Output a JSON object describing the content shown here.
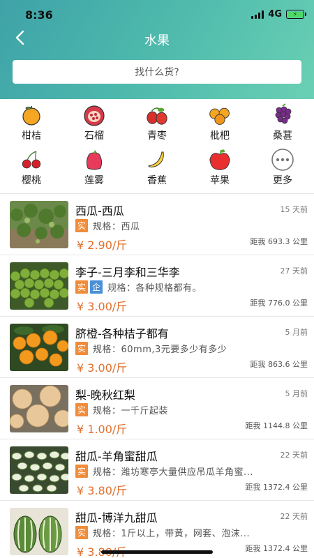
{
  "status_bar": {
    "time": "8:36",
    "network": "4G"
  },
  "nav": {
    "title": "水果"
  },
  "search": {
    "placeholder": "找什么货?"
  },
  "categories": [
    {
      "label": "柑桔",
      "icon": "tangerine-icon"
    },
    {
      "label": "石榴",
      "icon": "pomegranate-icon"
    },
    {
      "label": "青枣",
      "icon": "jujube-icon"
    },
    {
      "label": "枇杷",
      "icon": "loquat-icon"
    },
    {
      "label": "桑葚",
      "icon": "mulberry-icon"
    },
    {
      "label": "樱桃",
      "icon": "cherry-icon"
    },
    {
      "label": "莲雾",
      "icon": "wax-apple-icon"
    },
    {
      "label": "香蕉",
      "icon": "banana-icon"
    },
    {
      "label": "苹果",
      "icon": "apple-icon"
    },
    {
      "label": "更多",
      "icon": "more-icon"
    }
  ],
  "products": [
    {
      "title": "西瓜-西瓜",
      "time": "15 天前",
      "tags": [
        "实"
      ],
      "spec": "规格：西瓜",
      "price": "¥ 2.90/斤",
      "distance": "距我 693.3 公里"
    },
    {
      "title": "李子-三月李和三华李",
      "time": "27 天前",
      "tags": [
        "实",
        "企"
      ],
      "spec": "规格：各种规格都有。",
      "price": "¥ 3.00/斤",
      "distance": "距我 776.0 公里"
    },
    {
      "title": "脐橙-各种桔子都有",
      "time": "5 月前",
      "tags": [
        "实"
      ],
      "spec": "规格：60mm,3元要多少有多少",
      "price": "¥ 3.00/斤",
      "distance": "距我 863.6 公里"
    },
    {
      "title": "梨-晚秋红梨",
      "time": "5 月前",
      "tags": [
        "实"
      ],
      "spec": "规格：一千斤起装",
      "price": "¥ 1.00/斤",
      "distance": "距我 1144.8 公里"
    },
    {
      "title": "甜瓜-羊角蜜甜瓜",
      "time": "22 天前",
      "tags": [
        "实"
      ],
      "spec": "规格：潍坊寒亭大量供应吊瓜羊角蜜...",
      "price": "¥ 3.80/斤",
      "distance": "距我 1372.4 公里"
    },
    {
      "title": "甜瓜-博洋九甜瓜",
      "time": "22 天前",
      "tags": [
        "实"
      ],
      "spec": "规格：1斤以上，带黄，网套、泡沫...",
      "price": "¥ 3.80/斤",
      "distance": "距我 1372.4 公里"
    }
  ],
  "colors": {
    "header_start": "#3fa2a8",
    "header_end": "#6ad0b4",
    "price": "#e0702e",
    "tag_shi": "#f08c3a",
    "tag_qi": "#4a90d9"
  }
}
